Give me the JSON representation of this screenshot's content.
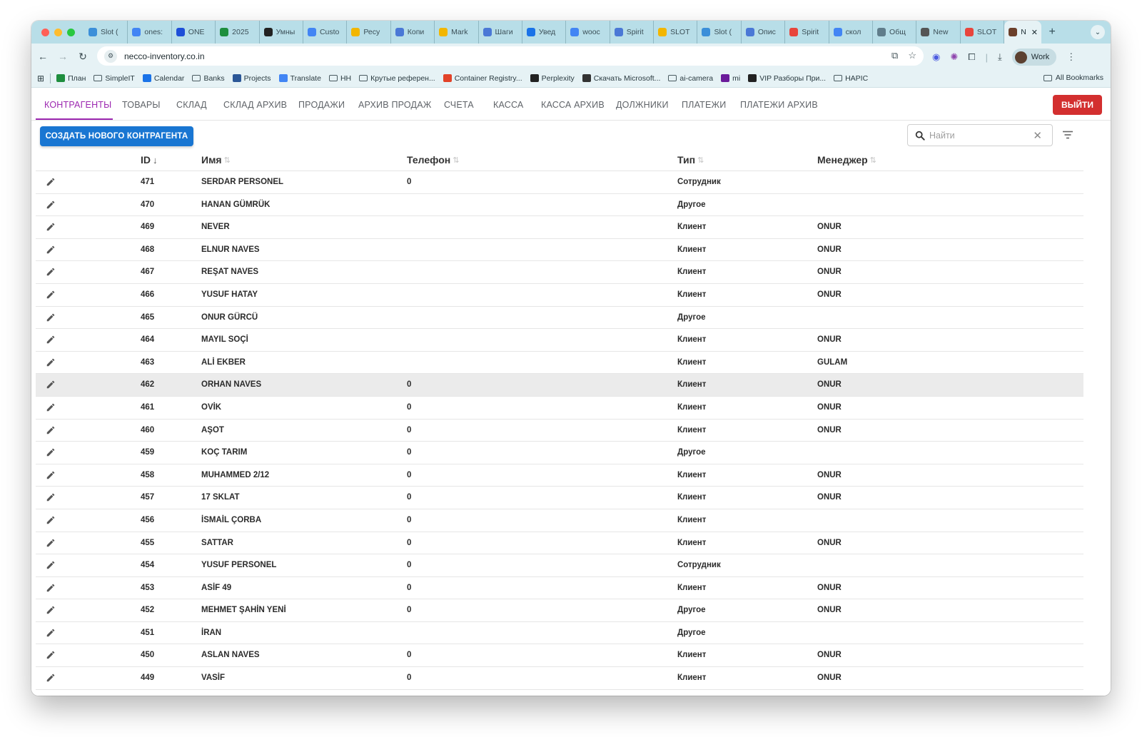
{
  "browser": {
    "tabs": [
      {
        "label": "Slot (",
        "color": "#3b8fd9"
      },
      {
        "label": "ones:",
        "color": "#4285f4"
      },
      {
        "label": "ONE",
        "color": "#1e4fd8"
      },
      {
        "label": "2025",
        "color": "#1e8e3e"
      },
      {
        "label": "Умны",
        "color": "#222222"
      },
      {
        "label": "Custo",
        "color": "#4285f4"
      },
      {
        "label": "Ресу",
        "color": "#f2b600"
      },
      {
        "label": "Копи",
        "color": "#4a78d6"
      },
      {
        "label": "Mark",
        "color": "#f2b600"
      },
      {
        "label": "Шаги",
        "color": "#4a78d6"
      },
      {
        "label": "Увед",
        "color": "#1a73e8"
      },
      {
        "label": "wooc",
        "color": "#4285f4"
      },
      {
        "label": "Spirit",
        "color": "#4a78d6"
      },
      {
        "label": "SLOT",
        "color": "#f2b600"
      },
      {
        "label": "Slot (",
        "color": "#3b8fd9"
      },
      {
        "label": "Опис",
        "color": "#4a78d6"
      },
      {
        "label": "Spirit",
        "color": "#e8453c"
      },
      {
        "label": "скол",
        "color": "#4285f4"
      },
      {
        "label": "Общ",
        "color": "#607d8b"
      },
      {
        "label": "New",
        "color": "#555555"
      },
      {
        "label": "SLOT",
        "color": "#e8453c"
      }
    ],
    "active_tab": {
      "label": "N",
      "close": "✕"
    },
    "new_tab": "+",
    "url": "necco-inventory.co.in",
    "profile": "Work",
    "bookmarks": [
      {
        "label": "План",
        "type": "icon",
        "color": "#1e8e3e"
      },
      {
        "label": "SimpleIT",
        "type": "folder"
      },
      {
        "label": "Calendar",
        "type": "icon",
        "color": "#1a73e8"
      },
      {
        "label": "Banks",
        "type": "folder"
      },
      {
        "label": "Projects",
        "type": "icon",
        "color": "#2b5797"
      },
      {
        "label": "Translate",
        "type": "icon",
        "color": "#4285f4"
      },
      {
        "label": "HH",
        "type": "folder"
      },
      {
        "label": "Крутые референ...",
        "type": "folder"
      },
      {
        "label": "Container Registry...",
        "type": "icon",
        "color": "#e24329"
      },
      {
        "label": "Perplexity",
        "type": "icon",
        "color": "#222222"
      },
      {
        "label": "Скачать Microsoft...",
        "type": "icon",
        "color": "#333333"
      },
      {
        "label": "ai-camera",
        "type": "folder"
      },
      {
        "label": "mi",
        "type": "icon",
        "color": "#6a1b9a"
      },
      {
        "label": "VIP Разборы При...",
        "type": "icon",
        "color": "#222222"
      },
      {
        "label": "HAPIC",
        "type": "folder"
      }
    ],
    "all_bookmarks": "All Bookmarks"
  },
  "app": {
    "nav_tabs": [
      "КОНТРАГЕНТЫ",
      "ТОВАРЫ",
      "СКЛАД",
      "СКЛАД АРХИВ",
      "ПРОДАЖИ",
      "АРХИВ ПРОДАЖ",
      "СЧЕТА",
      "КАССА",
      "КАССА АРХИВ",
      "ДОЛЖНИКИ",
      "ПЛАТЕЖИ",
      "ПЛАТЕЖИ АРХИВ"
    ],
    "active_tab": "КОНТРАГЕНТЫ",
    "logout_label": "ВЫЙТИ",
    "create_label": "СОЗДАТЬ НОВОГО КОНТРАГЕНТА",
    "search_placeholder": "Найти",
    "accent_color": "#9c27b0",
    "primary_color": "#1976d2",
    "danger_color": "#d32f2f",
    "columns": {
      "id": "ID",
      "name": "Имя",
      "phone": "Телефон",
      "type": "Тип",
      "manager": "Менеджер"
    },
    "sort_active": "↓",
    "sort_idle": "⇅",
    "rows": [
      {
        "id": "471",
        "name": "SERDAR PERSONEL",
        "phone": "0",
        "type": "Сотрудник",
        "manager": ""
      },
      {
        "id": "470",
        "name": "HANAN GÜMRÜK",
        "phone": "",
        "type": "Другое",
        "manager": ""
      },
      {
        "id": "469",
        "name": "NEVER",
        "phone": "",
        "type": "Клиент",
        "manager": "ONUR"
      },
      {
        "id": "468",
        "name": "ELNUR NAVES",
        "phone": "",
        "type": "Клиент",
        "manager": "ONUR"
      },
      {
        "id": "467",
        "name": "REŞAT NAVES",
        "phone": "",
        "type": "Клиент",
        "manager": "ONUR"
      },
      {
        "id": "466",
        "name": "YUSUF HATAY",
        "phone": "",
        "type": "Клиент",
        "manager": "ONUR"
      },
      {
        "id": "465",
        "name": "ONUR GÜRCÜ",
        "phone": "",
        "type": "Другое",
        "manager": ""
      },
      {
        "id": "464",
        "name": "MAYIL SOÇİ",
        "phone": "",
        "type": "Клиент",
        "manager": "ONUR"
      },
      {
        "id": "463",
        "name": "ALİ EKBER",
        "phone": "",
        "type": "Клиент",
        "manager": "GULAM"
      },
      {
        "id": "462",
        "name": "ORHAN NAVES",
        "phone": "0",
        "type": "Клиент",
        "manager": "ONUR",
        "highlighted": true
      },
      {
        "id": "461",
        "name": "OVİK",
        "phone": "0",
        "type": "Клиент",
        "manager": "ONUR"
      },
      {
        "id": "460",
        "name": "AŞOT",
        "phone": "0",
        "type": "Клиент",
        "manager": "ONUR"
      },
      {
        "id": "459",
        "name": "KOÇ TARIM",
        "phone": "0",
        "type": "Другое",
        "manager": ""
      },
      {
        "id": "458",
        "name": "MUHAMMED 2/12",
        "phone": "0",
        "type": "Клиент",
        "manager": "ONUR"
      },
      {
        "id": "457",
        "name": "17 SKLAT",
        "phone": "0",
        "type": "Клиент",
        "manager": "ONUR"
      },
      {
        "id": "456",
        "name": "İSMAİL ÇORBA",
        "phone": "0",
        "type": "Клиент",
        "manager": ""
      },
      {
        "id": "455",
        "name": "SATTAR",
        "phone": "0",
        "type": "Клиент",
        "manager": "ONUR"
      },
      {
        "id": "454",
        "name": "YUSUF PERSONEL",
        "phone": "0",
        "type": "Сотрудник",
        "manager": ""
      },
      {
        "id": "453",
        "name": "ASİF 49",
        "phone": "0",
        "type": "Клиент",
        "manager": "ONUR"
      },
      {
        "id": "452",
        "name": "MEHMET ŞAHİN YENİ",
        "phone": "0",
        "type": "Другое",
        "manager": "ONUR"
      },
      {
        "id": "451",
        "name": "İRAN",
        "phone": "",
        "type": "Другое",
        "manager": ""
      },
      {
        "id": "450",
        "name": "ASLAN NAVES",
        "phone": "0",
        "type": "Клиент",
        "manager": "ONUR"
      },
      {
        "id": "449",
        "name": "VASİF",
        "phone": "0",
        "type": "Клиент",
        "manager": "ONUR"
      }
    ]
  }
}
